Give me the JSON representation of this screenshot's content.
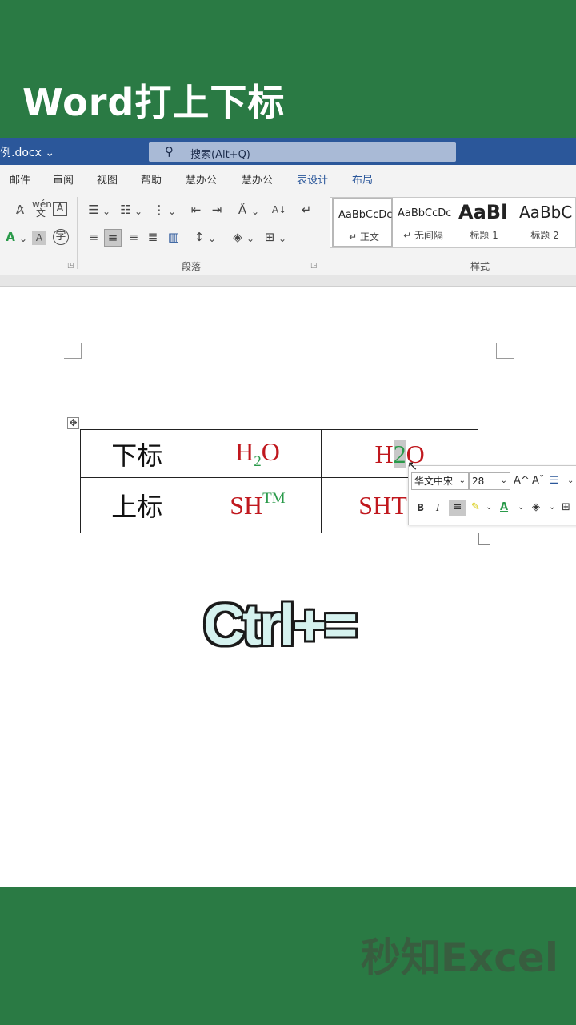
{
  "banner": {
    "title": "Word打上下标",
    "watermark": "秒知Excel",
    "bg_color": "#2a7a44"
  },
  "word": {
    "filename": "例.docx ⌄",
    "search_placeholder": "搜索(Alt+Q)",
    "search_icon": "search-icon"
  },
  "ribbon_tabs": [
    "邮件",
    "审阅",
    "视图",
    "帮助",
    "慧办公",
    "慧办公",
    "表设计",
    "布局"
  ],
  "ribbon": {
    "font_group": {
      "phonetic": "wén",
      "phonetic_char": "文"
    },
    "paragraph_label": "段落",
    "styles_label": "样式",
    "styles": [
      {
        "sample": "AaBbCcDc",
        "name": "↵ 正文"
      },
      {
        "sample": "AaBbCcDc",
        "name": "↵ 无间隔"
      },
      {
        "sample": "AaBl",
        "name": "标题 1"
      },
      {
        "sample": "AaBbC",
        "name": "标题 2"
      }
    ]
  },
  "table": {
    "rows": [
      {
        "label": "下标",
        "example": {
          "base": "H",
          "script": "2",
          "tail": "O"
        },
        "editing": {
          "base": "H",
          "selected": "2",
          "tail": "O"
        }
      },
      {
        "label": "上标",
        "example": {
          "base": "SH",
          "script": "TM"
        },
        "editing": {
          "base": "SH",
          "tail": "T"
        }
      }
    ]
  },
  "mini_toolbar": {
    "font": "华文中宋",
    "size": "28",
    "bold": "B",
    "italic": "I",
    "grow_font": "A^",
    "shrink_font": "Aˇ"
  },
  "shortcut": "Ctrl+=",
  "colors": {
    "word_blue": "#2b579a",
    "chem_red": "#c0181e",
    "script_green": "#2a9a4a"
  }
}
